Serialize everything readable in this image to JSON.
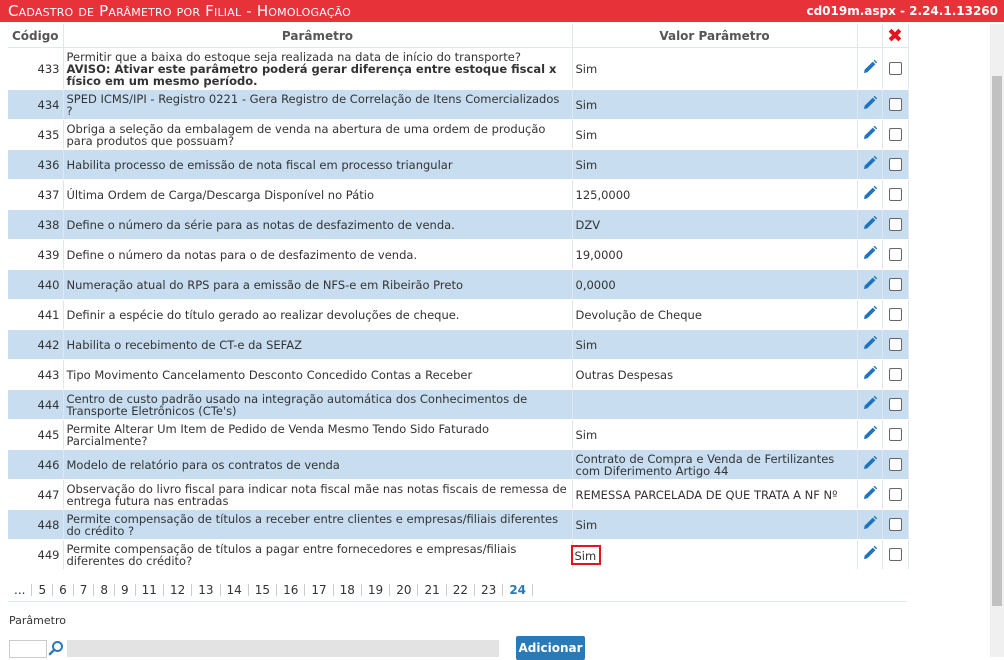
{
  "window": {
    "title": "Cadastro de Parâmetro por Filial   - Homologação",
    "version": "cd019m.aspx - 2.24.1.13260"
  },
  "table": {
    "headers": {
      "code": "Código",
      "param": "Parâmetro",
      "value": "Valor Parâmetro",
      "delete_icon": "delete-x-icon"
    },
    "rows": [
      {
        "code": "433",
        "param": "Permitir que a baixa do estoque seja realizada na data de início do transporte?",
        "param_bold": " AVISO: Ativar este parâmetro poderá gerar diferença entre estoque fiscal x físico em um mesmo período.",
        "value": "Sim"
      },
      {
        "code": "434",
        "param": "SPED ICMS/IPI - Registro 0221 - Gera Registro de Correlação de Itens Comercializados ?",
        "value": "Sim"
      },
      {
        "code": "435",
        "param": "Obriga a seleção da embalagem de venda na abertura de uma ordem de produção para produtos que possuam?",
        "value": "Sim"
      },
      {
        "code": "436",
        "param": "Habilita processo de emissão de nota fiscal em processo triangular",
        "value": "Sim"
      },
      {
        "code": "437",
        "param": "Última Ordem de Carga/Descarga Disponível no Pátio",
        "value": "125,0000"
      },
      {
        "code": "438",
        "param": "Define o número da série para as notas de desfazimento de venda.",
        "value": "DZV"
      },
      {
        "code": "439",
        "param": "Define o número da notas para o de desfazimento de venda.",
        "value": "19,0000"
      },
      {
        "code": "440",
        "param": "Numeração atual do RPS para a emissão de NFS-e em Ribeirão Preto",
        "value": "0,0000"
      },
      {
        "code": "441",
        "param": "Definir a espécie do título gerado ao realizar devoluções de cheque.",
        "value": "Devolução de Cheque"
      },
      {
        "code": "442",
        "param": "Habilita o recebimento de CT-e da SEFAZ",
        "value": "Sim"
      },
      {
        "code": "443",
        "param": "Tipo Movimento Cancelamento Desconto Concedido Contas a Receber",
        "value": "Outras Despesas"
      },
      {
        "code": "444",
        "param": "Centro de custo padrão usado na integração automática dos Conhecimentos de Transporte Eletrônicos (CTe's)",
        "value": ""
      },
      {
        "code": "445",
        "param": "Permite Alterar Um Item de Pedido de Venda Mesmo Tendo Sido Faturado Parcialmente?",
        "value": "Sim"
      },
      {
        "code": "446",
        "param": "Modelo de relatório para os contratos de venda",
        "value": "Contrato de Compra e Venda de Fertilizantes com Diferimento Artigo 44"
      },
      {
        "code": "447",
        "param": "Observação do livro fiscal para indicar nota fiscal mãe nas notas fiscais de remessa de entrega futura nas entradas",
        "value": "REMESSA PARCELADA DE QUE TRATA A NF Nº"
      },
      {
        "code": "448",
        "param": "Permite compensação de títulos a receber entre clientes e empresas/filiais diferentes do crédito ?",
        "value": "Sim"
      },
      {
        "code": "449",
        "param": "Permite compensação de títulos a pagar entre fornecedores e empresas/filiais diferentes do crédito?",
        "value": "Sim"
      }
    ],
    "edit_icon": "pencil-icon",
    "checkbox_checked": false
  },
  "pager": {
    "pages": [
      "...",
      "5",
      "6",
      "7",
      "8",
      "9",
      "11",
      "12",
      "13",
      "14",
      "15",
      "16",
      "17",
      "18",
      "19",
      "20",
      "21",
      "22",
      "23",
      "24"
    ],
    "current": "24"
  },
  "form": {
    "param_label": "Parâmetro",
    "code_value": "",
    "desc_value": "",
    "search_icon": "magnifier-icon",
    "add_label": "Adicionar"
  },
  "colors": {
    "titlebar": "#e8323a",
    "row_alt": "#c8def0",
    "accent": "#2b7ab8",
    "highlight": "#e3141d"
  }
}
